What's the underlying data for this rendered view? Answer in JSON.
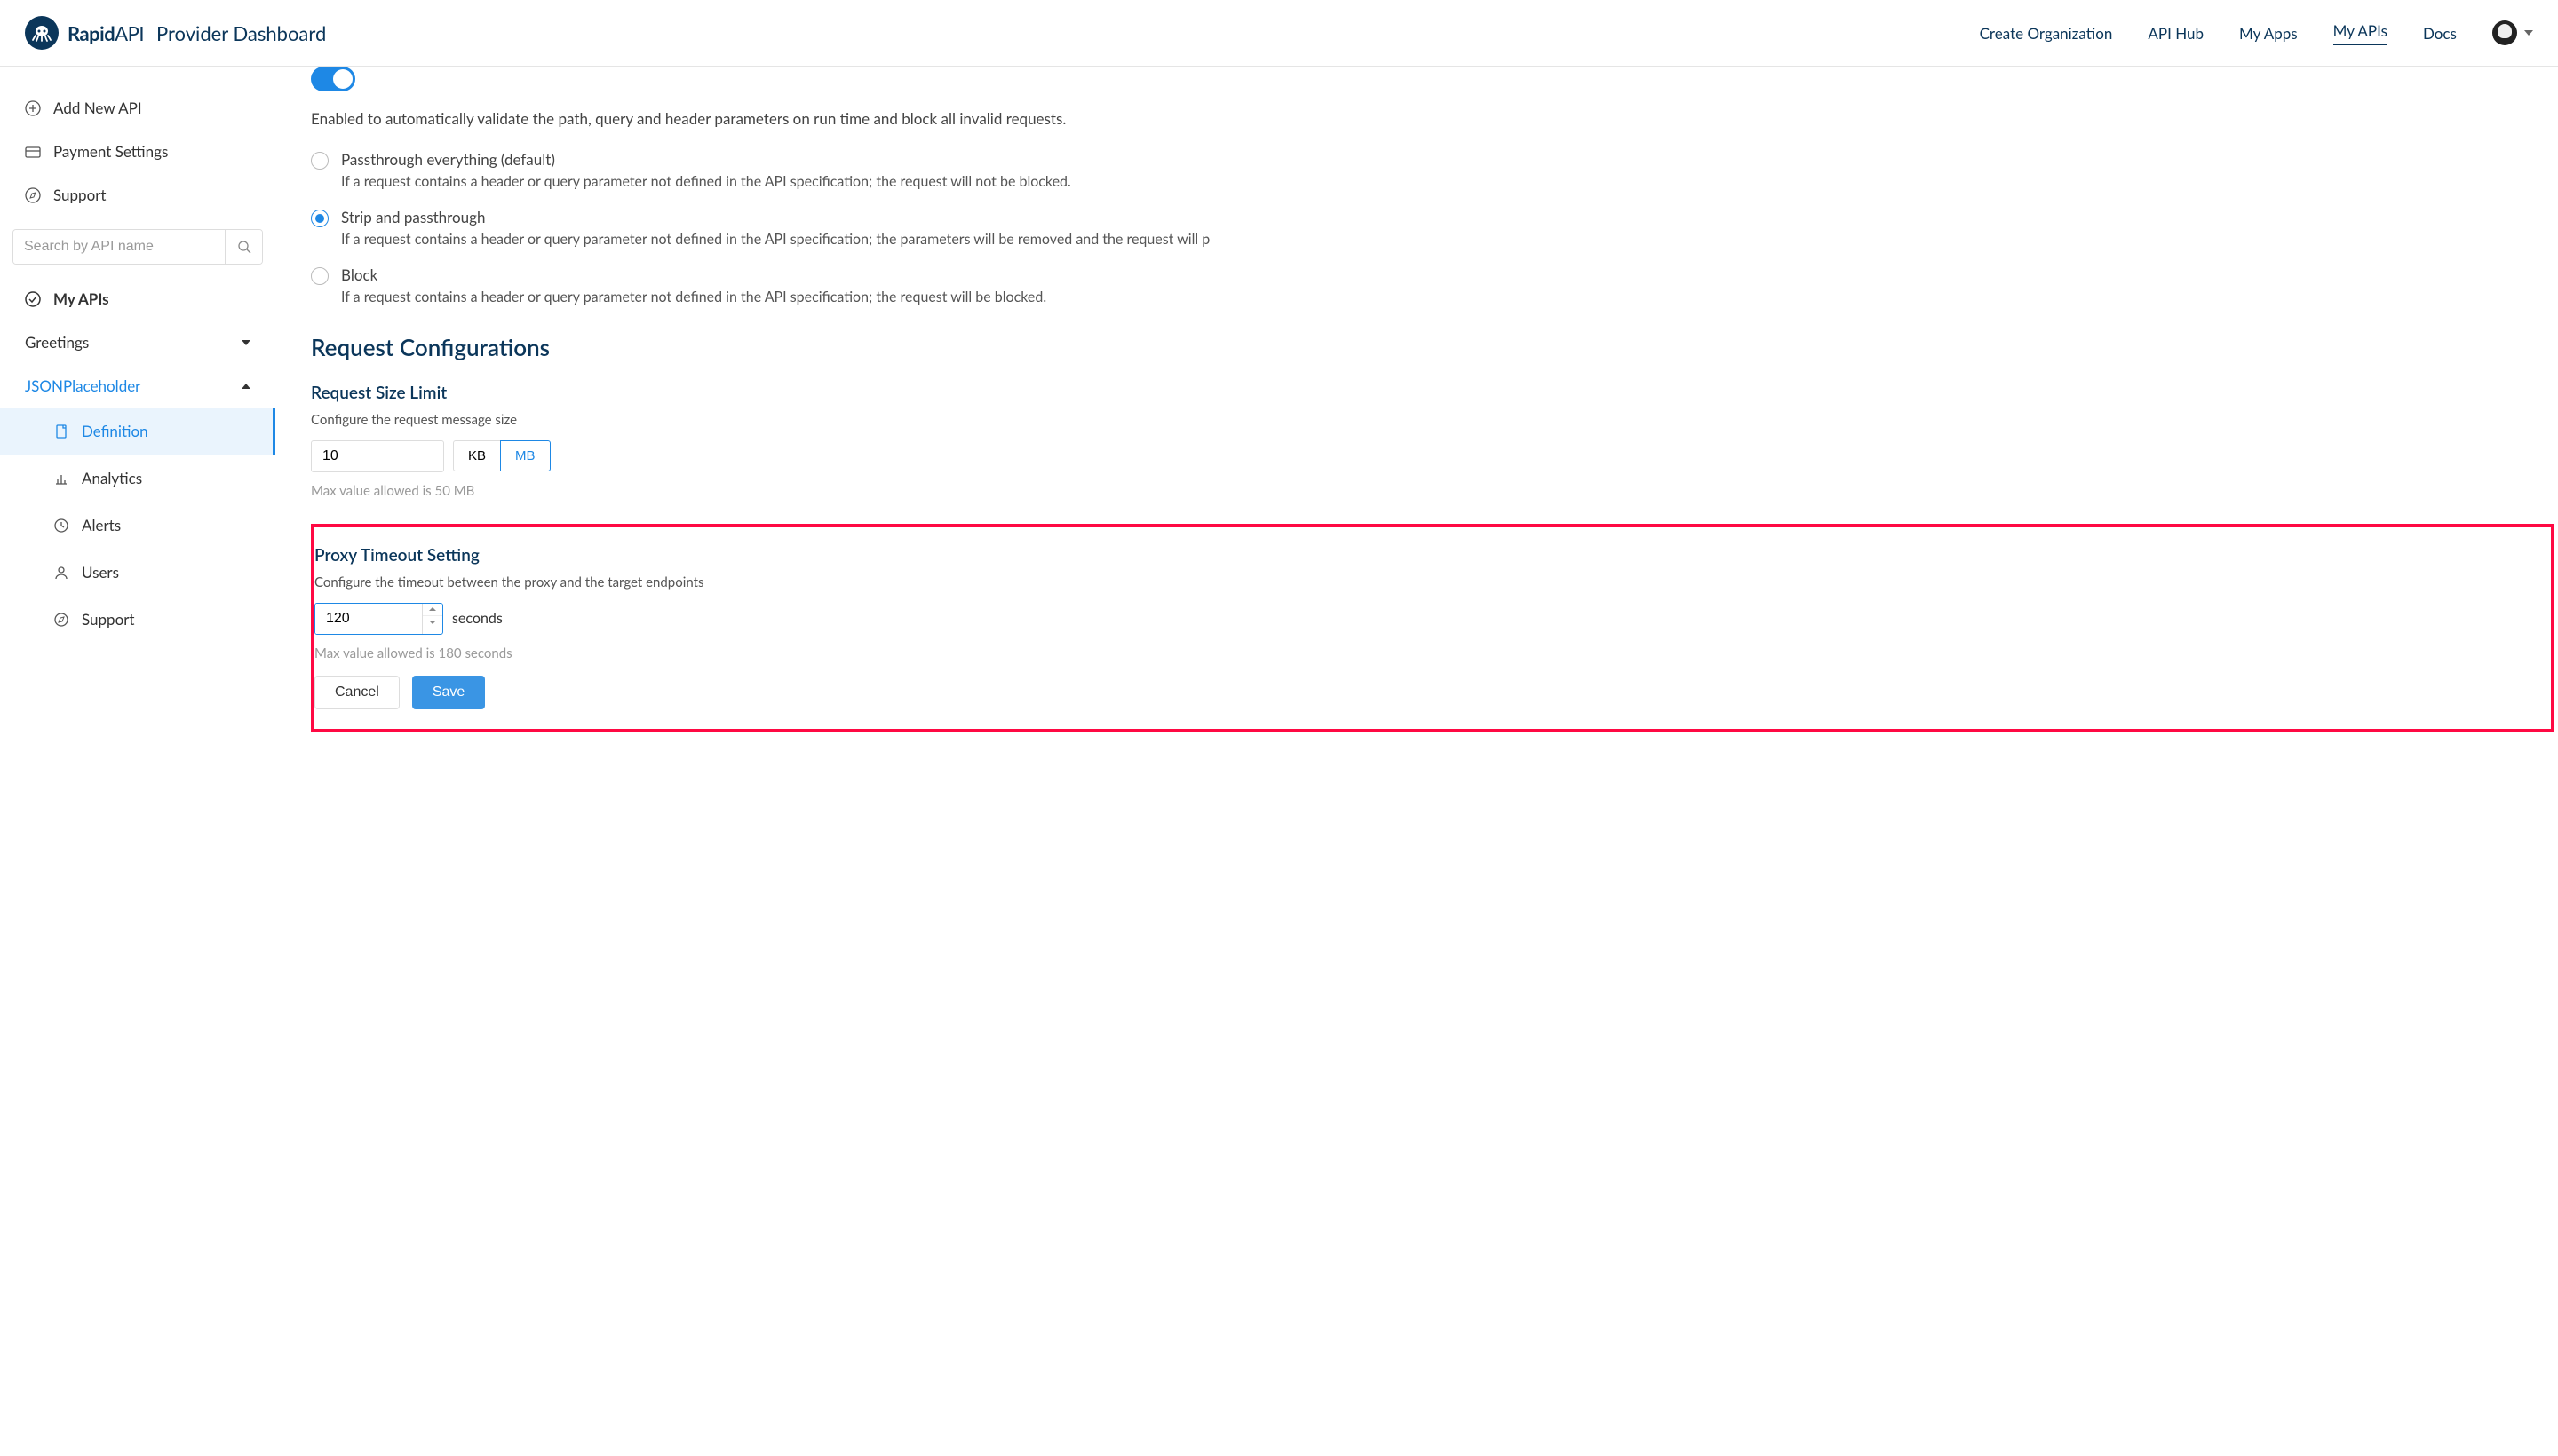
{
  "header": {
    "brand_bold": "Rapid",
    "brand_thin": "API",
    "subtitle": "Provider Dashboard",
    "nav": {
      "create_org": "Create Organization",
      "api_hub": "API Hub",
      "my_apps": "My Apps",
      "my_apis": "My APIs",
      "docs": "Docs"
    }
  },
  "sidebar": {
    "add_new_api": "Add New API",
    "payment_settings": "Payment Settings",
    "support": "Support",
    "search_placeholder": "Search by API name",
    "my_apis": "My APIs",
    "apis": {
      "greetings": "Greetings",
      "jsonplaceholder": "JSONPlaceholder"
    },
    "subnav": {
      "definition": "Definition",
      "analytics": "Analytics",
      "alerts": "Alerts",
      "users": "Users",
      "support": "Support"
    }
  },
  "main": {
    "validation_desc": "Enabled to automatically validate the path, query and header parameters on run time and block all invalid requests.",
    "radios": {
      "passthrough": {
        "label": "Passthrough everything (default)",
        "desc": "If a request contains a header or query parameter not defined in the API specification; the request will not be blocked."
      },
      "strip": {
        "label": "Strip and passthrough",
        "desc": "If a request contains a header or query parameter not defined in the API specification; the parameters will be removed and the request will p"
      },
      "block": {
        "label": "Block",
        "desc": "If a request contains a header or query parameter not defined in the API specification; the request will be blocked."
      }
    },
    "request_config_title": "Request Configurations",
    "size_limit": {
      "title": "Request Size Limit",
      "desc": "Configure the request message size",
      "value": "10",
      "unit_kb": "KB",
      "unit_mb": "MB",
      "hint": "Max value allowed is 50 MB"
    },
    "proxy_timeout": {
      "title": "Proxy Timeout Setting",
      "desc": "Configure the timeout between the proxy and the target endpoints",
      "value": "120",
      "unit": "seconds",
      "hint": "Max value allowed is 180 seconds",
      "cancel": "Cancel",
      "save": "Save"
    }
  }
}
